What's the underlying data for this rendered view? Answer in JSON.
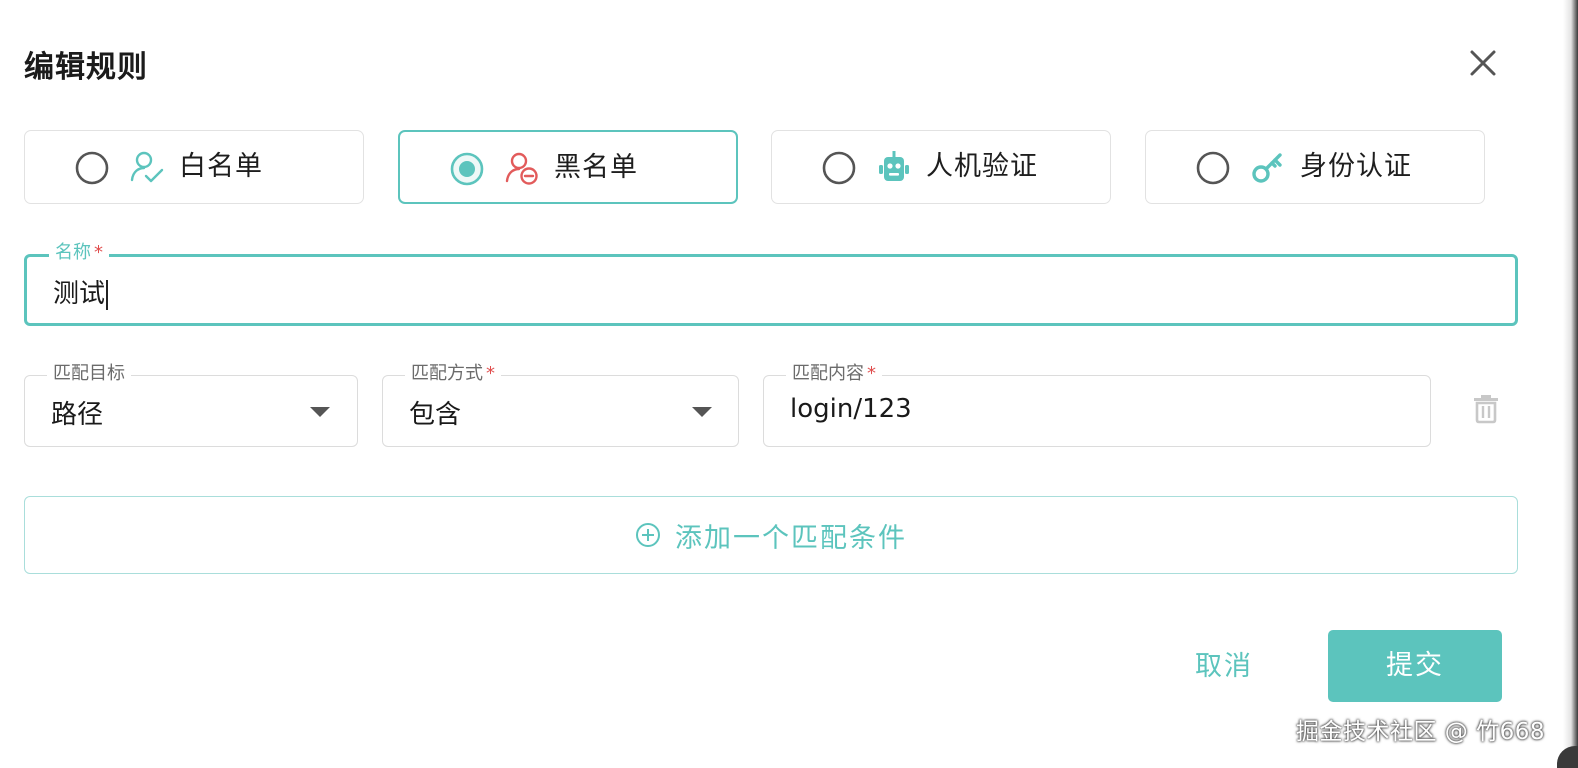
{
  "dialog": {
    "title": "编辑规则"
  },
  "rule_types": {
    "options": [
      {
        "label": "白名单",
        "icon": "user-check-icon",
        "selected": false
      },
      {
        "label": "黑名单",
        "icon": "user-block-icon",
        "selected": true
      },
      {
        "label": "人机验证",
        "icon": "robot-icon",
        "selected": false
      },
      {
        "label": "身份认证",
        "icon": "key-icon",
        "selected": false
      }
    ]
  },
  "name_field": {
    "label": "名称",
    "required_mark": "*",
    "value": "测试"
  },
  "match_row": {
    "target": {
      "label": "匹配目标",
      "value": "路径"
    },
    "method": {
      "label": "匹配方式",
      "required_mark": "*",
      "value": "包含"
    },
    "content": {
      "label": "匹配内容",
      "required_mark": "*",
      "value": "login/123"
    }
  },
  "add_condition": {
    "label": "添加一个匹配条件"
  },
  "footer": {
    "cancel_label": "取消",
    "submit_label": "提交"
  },
  "watermark": "掘金技术社区 @ 竹668",
  "colors": {
    "accent": "#5cc4bd",
    "danger": "#e25b5b",
    "required": "#e04d4d"
  }
}
